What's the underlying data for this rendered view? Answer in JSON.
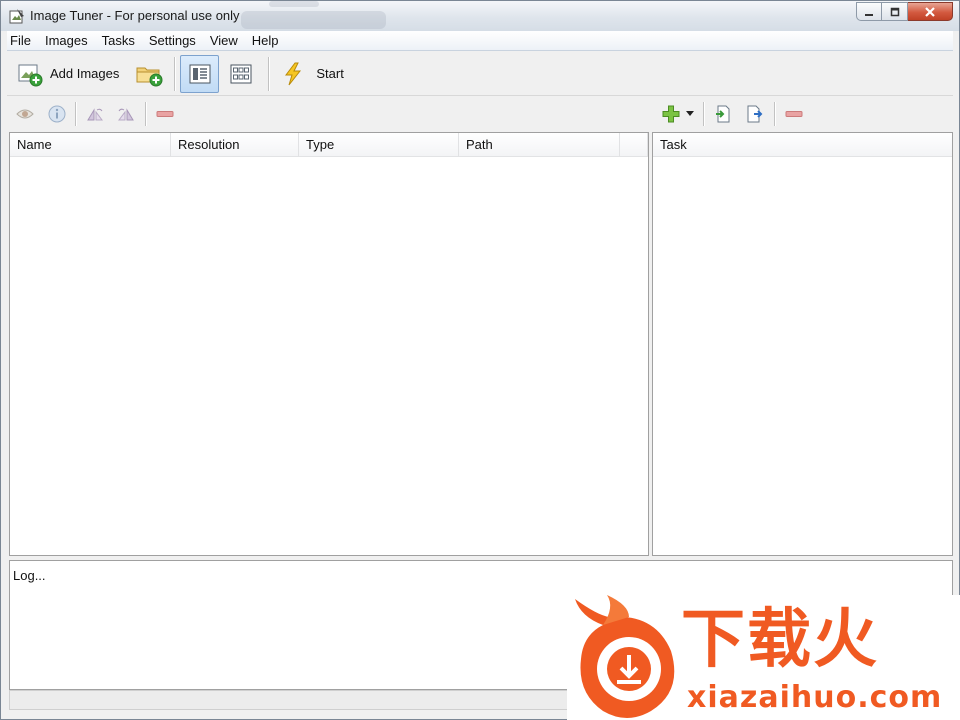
{
  "window": {
    "title": "Image Tuner - For personal use only"
  },
  "menu": {
    "items": [
      "File",
      "Images",
      "Tasks",
      "Settings",
      "View",
      "Help"
    ]
  },
  "toolbar": {
    "add_images_label": "Add Images",
    "start_label": "Start",
    "view_mode": "details"
  },
  "images_list": {
    "columns": [
      "Name",
      "Resolution",
      "Type",
      "Path"
    ],
    "rows": []
  },
  "task_list": {
    "columns": [
      "Task"
    ],
    "rows": []
  },
  "log": {
    "text": "Log..."
  },
  "watermark": {
    "brand_text": "下载火",
    "url": "xiazaihuo.com",
    "color": "#f05a22"
  }
}
